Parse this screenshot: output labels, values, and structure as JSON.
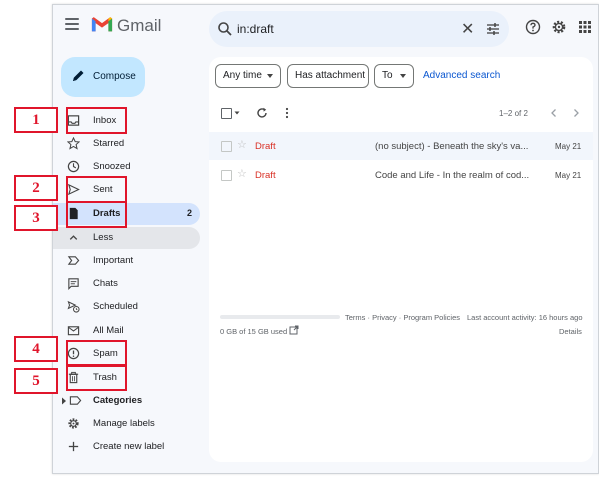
{
  "app": {
    "name": "Gmail"
  },
  "search": {
    "query": "in:draft"
  },
  "compose": {
    "label": "Compose"
  },
  "sidebar": {
    "items": [
      {
        "label": "Inbox",
        "icon": "inbox-icon"
      },
      {
        "label": "Starred",
        "icon": "star-icon"
      },
      {
        "label": "Snoozed",
        "icon": "clock-icon"
      },
      {
        "label": "Sent",
        "icon": "send-icon"
      },
      {
        "label": "Drafts",
        "icon": "draft-icon",
        "count": "2",
        "active": true
      },
      {
        "label": "Less",
        "icon": "chevron-up-icon"
      },
      {
        "label": "Important",
        "icon": "important-icon"
      },
      {
        "label": "Chats",
        "icon": "chat-icon"
      },
      {
        "label": "Scheduled",
        "icon": "scheduled-icon"
      },
      {
        "label": "All Mail",
        "icon": "all-mail-icon"
      },
      {
        "label": "Spam",
        "icon": "spam-icon"
      },
      {
        "label": "Trash",
        "icon": "trash-icon"
      },
      {
        "label": "Categories",
        "icon": "label-icon"
      },
      {
        "label": "Manage labels",
        "icon": "gear-icon"
      },
      {
        "label": "Create new label",
        "icon": "plus-icon"
      }
    ]
  },
  "filters": {
    "any_time": "Any time",
    "has_attachment": "Has attachment",
    "to": "To",
    "advanced": "Advanced search"
  },
  "toolbar": {
    "pagination": "1–2 of 2"
  },
  "emails": [
    {
      "sender": "Draft",
      "snippet": "(no subject) - Beneath the sky's va...",
      "date": "May 21"
    },
    {
      "sender": "Draft",
      "snippet": "Code and Life - In the realm of cod...",
      "date": "May 21"
    }
  ],
  "footer": {
    "links": "Terms · Privacy · Program Policies",
    "activity": "Last account activity: 16 hours ago",
    "storage": "0 GB of 15 GB used",
    "details": "Details"
  },
  "annotations": {
    "labels": [
      "1",
      "2",
      "3",
      "4",
      "5"
    ]
  },
  "colors": {
    "annotation": "#e0152b",
    "accent": "#0b57d0",
    "draft": "#d93025"
  }
}
